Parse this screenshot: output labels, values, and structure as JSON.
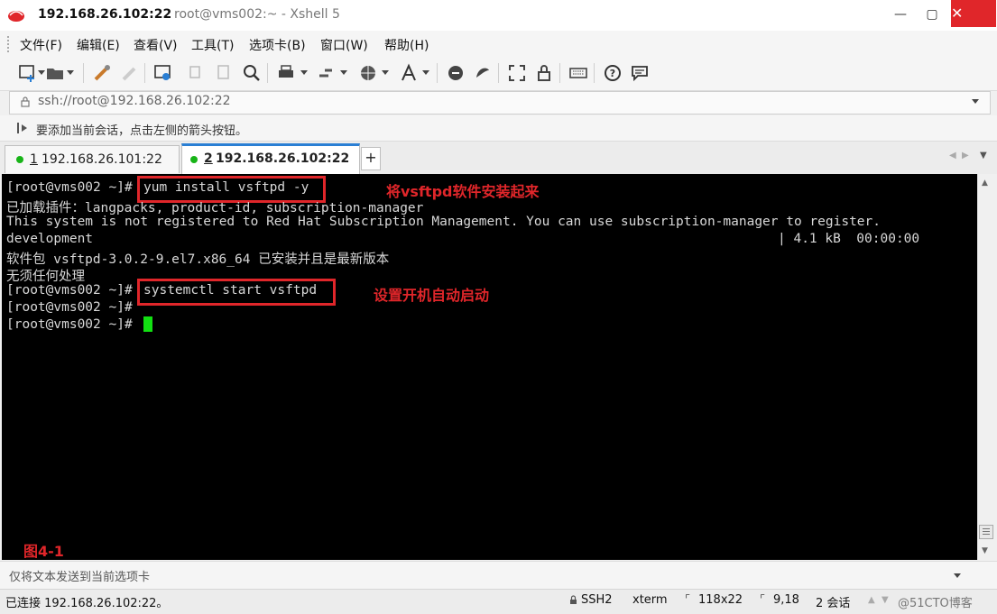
{
  "window": {
    "title_host": "192.168.26.102:22",
    "title_rest": "root@vms002:~ - Xshell 5"
  },
  "menu": [
    "文件(F)",
    "编辑(E)",
    "查看(V)",
    "工具(T)",
    "选项卡(B)",
    "窗口(W)",
    "帮助(H)"
  ],
  "address": {
    "value": "ssh://root@192.168.26.102:22"
  },
  "hint": {
    "text": "要添加当前会话，点击左侧的箭头按钮。"
  },
  "tabs": [
    {
      "index": "1",
      "label": "192.168.26.101:22",
      "active": false
    },
    {
      "index": "2",
      "label": "192.168.26.102:22",
      "active": true
    }
  ],
  "tab_add": "+",
  "terminal": {
    "prompt": "[root@vms002 ~]#",
    "cmd1": "yum install vsftpd -y",
    "line2": "已加载插件：langpacks, product-id, subscription-manager",
    "line3": "This system is not registered to Red Hat Subscription Management. You can use subscription-manager to register.",
    "line4a": "development",
    "line4b": "| 4.1 kB  00:00:00",
    "line5": "软件包 vsftpd-3.0.2-9.el7.x86_64 已安装并且是最新版本",
    "line6": "无须任何处理",
    "cmd2": "systemctl start vsftpd",
    "annotation1": "将vsftpd软件安装起来",
    "annotation2": "设置开机自动启动",
    "figure_label": "图4-1"
  },
  "input_bar": {
    "placeholder": "仅将文本发送到当前选项卡"
  },
  "status": {
    "connected": "已连接 192.168.26.102:22。",
    "protocol": "SSH2",
    "term": "xterm",
    "size": "118x22",
    "cursor_pos": "9,18",
    "sessions": "2 会话",
    "watermark": "@51CTO博客"
  },
  "colors": {
    "accent_red": "#e0262a",
    "tab_blue": "#2a7fd4",
    "cursor_green": "#12e012"
  }
}
